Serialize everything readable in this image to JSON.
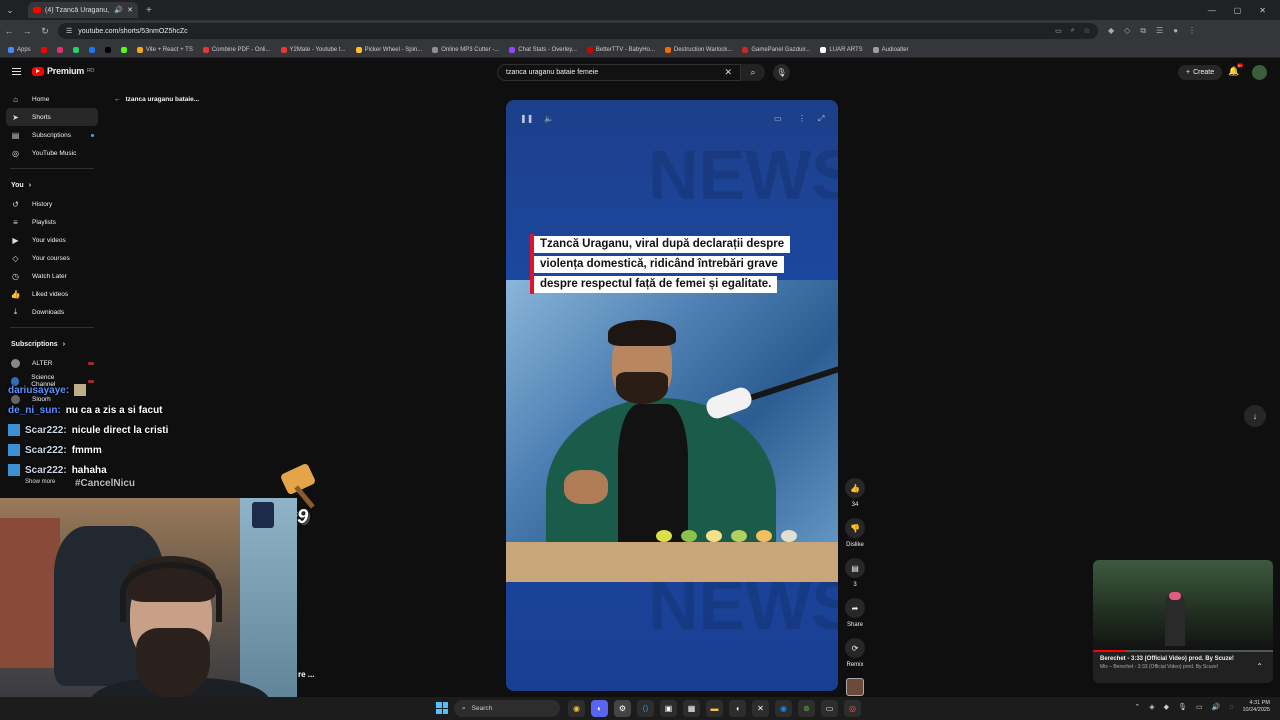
{
  "browser": {
    "tab_title": "(4) Tzancă Uraganu, viral d...",
    "url": "youtube.com/shorts/53nmOZ5hcZc",
    "bookmarks": [
      "Apps",
      "Vite + React + TS",
      "Combine PDF - Onli...",
      "Y2Mate - Youtube t...",
      "Picker Wheel - Spin...",
      "Online MP3 Cutter -...",
      "Chat Stats - Overley...",
      "BetterTTV - BabyHo...",
      "Destruction Warlock...",
      "GamePanel Gazduir...",
      "LUAR ARTS",
      "Audioalter"
    ]
  },
  "header": {
    "logo_text": "Premium",
    "logo_sup": "RO",
    "search_value": "tzanca uraganu bataie femeie",
    "create_label": "Create",
    "notif_count": "9+"
  },
  "sidebar": {
    "items": [
      {
        "label": "Home",
        "icon": "home-icon"
      },
      {
        "label": "Shorts",
        "icon": "shorts-icon"
      },
      {
        "label": "Subscriptions",
        "icon": "subscriptions-icon"
      },
      {
        "label": "YouTube Music",
        "icon": "music-icon"
      }
    ],
    "you_label": "You",
    "you_items": [
      {
        "label": "History"
      },
      {
        "label": "Playlists"
      },
      {
        "label": "Your videos"
      },
      {
        "label": "Your courses"
      },
      {
        "label": "Watch Later"
      },
      {
        "label": "Liked videos"
      },
      {
        "label": "Downloads"
      }
    ],
    "subscriptions_label": "Subscriptions",
    "subscriptions": [
      {
        "label": "ALTER"
      },
      {
        "label": "Science Channel"
      },
      {
        "label": "Sloorh"
      }
    ],
    "show_more": "Show more"
  },
  "back_link": "tzanca uraganu bataie...",
  "short": {
    "caption_lines": [
      "Tzancă Uraganu, viral după declarații despre",
      "violența domestică, ridicând întrebări grave",
      "despre respectul față de femei și egalitate."
    ],
    "watermark": "NEWS"
  },
  "actions": {
    "likes": "34",
    "dislike_label": "Dislike",
    "comments": "3",
    "share_label": "Share",
    "remix_label": "Remix"
  },
  "miniplayer": {
    "title": "Berechet - 3:33 (Official Video) prod. By Scuze!",
    "subtitle": "Mix – Berechet - 3:33 (Official Video) prod. By Scuze!",
    "progress": 0.18
  },
  "chat": {
    "messages": [
      {
        "user": "dariusayaye:",
        "text": ""
      },
      {
        "user": "de_ni_sun:",
        "text": "nu ca a zis a si facut"
      },
      {
        "user": "Scar222:",
        "text": "nicule direct la cristi"
      },
      {
        "user": "Scar222:",
        "text": "fmmm"
      },
      {
        "user": "Scar222:",
        "text": "hahaha"
      }
    ],
    "tag": "#CancelNicu",
    "multiplier": "x9"
  },
  "webcam_caption": "re ...",
  "taskbar": {
    "search_label": "Search",
    "time": "4:31 PM",
    "date": "10/24/2025"
  }
}
